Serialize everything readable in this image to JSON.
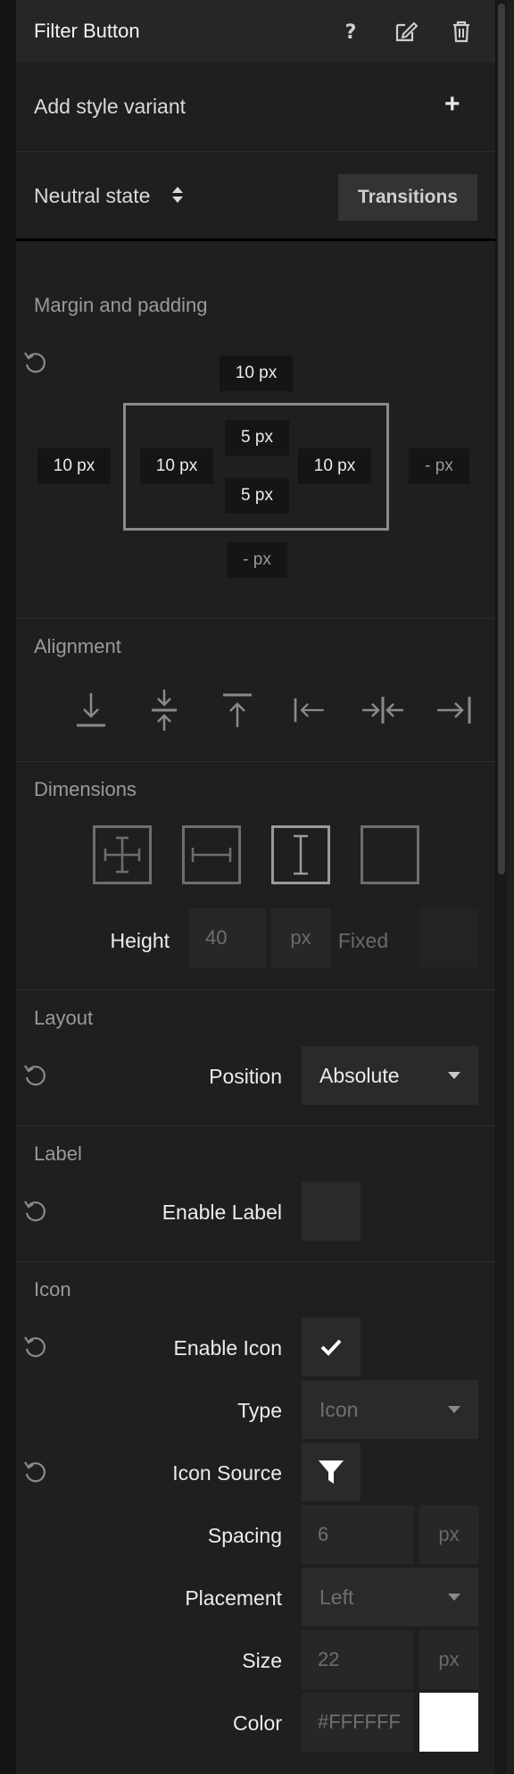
{
  "header": {
    "title": "Filter Button"
  },
  "variant": {
    "label": "Add style variant"
  },
  "state": {
    "label": "Neutral state",
    "transitions_label": "Transitions"
  },
  "margin_padding": {
    "title": "Margin and padding",
    "margin_top": "10 px",
    "margin_left": "10 px",
    "margin_right": "- px",
    "margin_bottom": "- px",
    "padding_top": "5 px",
    "padding_left": "10 px",
    "padding_right": "10 px",
    "padding_bottom": "5 px"
  },
  "alignment": {
    "title": "Alignment",
    "icons": [
      "align-bottom-icon",
      "align-vertical-center-icon",
      "align-top-icon",
      "align-left-icon",
      "align-horizontal-center-icon",
      "align-right-icon"
    ]
  },
  "dimensions": {
    "title": "Dimensions",
    "icons": [
      "size-both-icon",
      "size-width-icon",
      "size-height-icon",
      "size-none-icon"
    ],
    "selected": "size-height-icon",
    "height_label": "Height",
    "height_value": "40",
    "height_unit": "px",
    "fixed_label": "Fixed"
  },
  "layout": {
    "title": "Layout",
    "position_label": "Position",
    "position_value": "Absolute"
  },
  "label_section": {
    "title": "Label",
    "enable_label": "Enable Label",
    "enabled": false
  },
  "icon_section": {
    "title": "Icon",
    "enable_icon": "Enable Icon",
    "enabled": true,
    "type_label": "Type",
    "type_value": "Icon",
    "source_label": "Icon Source",
    "source_icon": "filter-icon",
    "spacing_label": "Spacing",
    "spacing_value": "6",
    "spacing_unit": "px",
    "placement_label": "Placement",
    "placement_value": "Left",
    "size_label": "Size",
    "size_value": "22",
    "size_unit": "px",
    "color_label": "Color",
    "color_value": "#FFFFFF"
  },
  "colors": {
    "panel_bg": "#1f1f1f",
    "header_bg": "#262626",
    "chip_bg": "#151515",
    "input_bg": "#272727"
  }
}
